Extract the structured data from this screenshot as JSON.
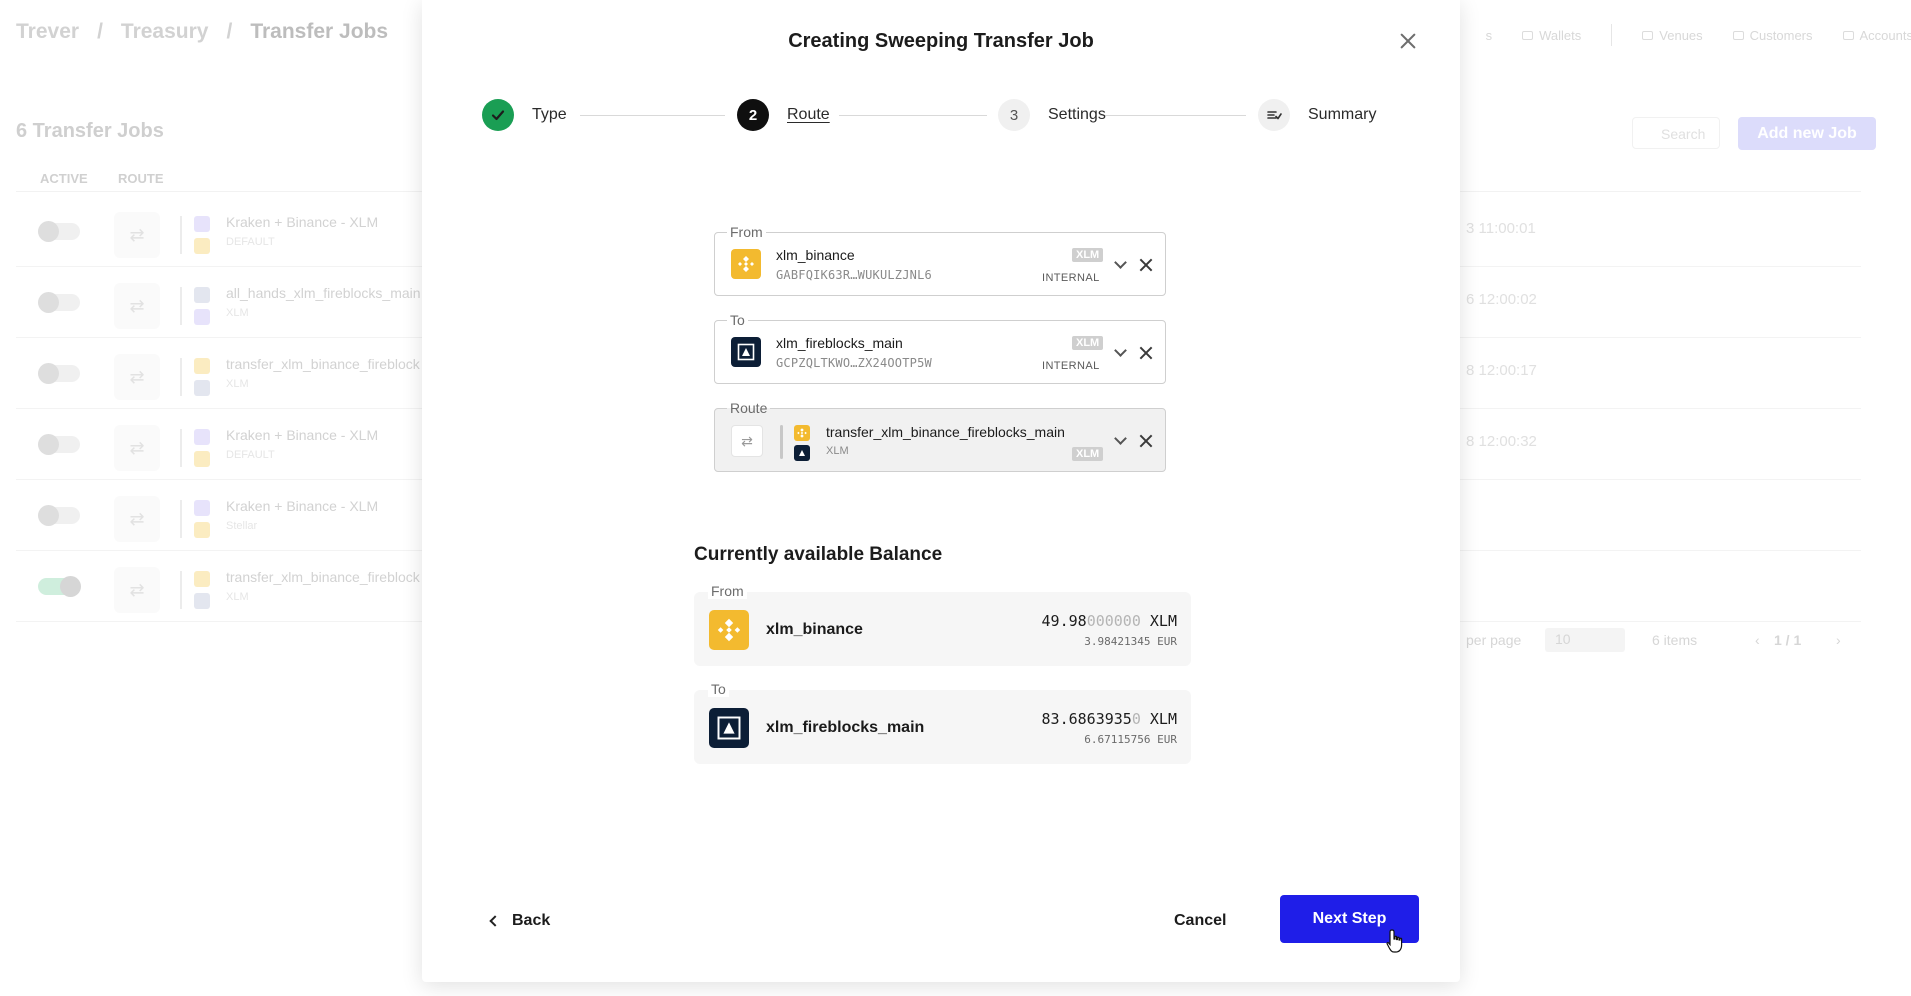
{
  "background": {
    "breadcrumb": [
      "Trever",
      "/",
      "Treasury",
      "/",
      "Transfer Jobs"
    ],
    "top_nav": [
      "s",
      "Wallets",
      "Venues",
      "Customers",
      "Accounts"
    ],
    "job_count": "6 Transfer Jobs",
    "search_placeholder": "Search",
    "add_job_label": "Add new Job",
    "columns": [
      "ACTIVE",
      "ROUTE"
    ],
    "rows": [
      {
        "name": "Kraken + Binance - XLM",
        "sub": "DEFAULT",
        "time": "3 11:00:01",
        "active": false
      },
      {
        "name": "all_hands_xlm_fireblocks_main",
        "sub": "XLM",
        "time": "6 12:00:02",
        "active": false
      },
      {
        "name": "transfer_xlm_binance_fireblock",
        "sub": "XLM",
        "time": "8 12:00:17",
        "active": false
      },
      {
        "name": "Kraken + Binance - XLM",
        "sub": "DEFAULT",
        "time": "8 12:00:32",
        "active": false
      },
      {
        "name": "Kraken + Binance - XLM",
        "sub": "Stellar",
        "time": "",
        "active": false
      },
      {
        "name": "transfer_xlm_binance_fireblock",
        "sub": "XLM",
        "time": "",
        "active": true
      }
    ],
    "pager": {
      "per_page_label": "per page",
      "per_page_value": "10",
      "items": "6 items",
      "page": "1 / 1"
    }
  },
  "modal": {
    "title": "Creating Sweeping Transfer Job",
    "steps": [
      {
        "label": "Type",
        "state": "done",
        "marker": ""
      },
      {
        "label": "Route",
        "state": "active",
        "marker": "2"
      },
      {
        "label": "Settings",
        "state": "todo",
        "marker": "3"
      },
      {
        "label": "Summary",
        "state": "todo",
        "marker": ""
      }
    ],
    "from_field": {
      "legend": "From",
      "name": "xlm_binance",
      "address": "GABFQIK63R…WUKULZJNL6",
      "asset": "XLM",
      "kind": "INTERNAL"
    },
    "to_field": {
      "legend": "To",
      "name": "xlm_fireblocks_main",
      "address": "GCPZQLTKWO…ZX24OOTP5W",
      "asset": "XLM",
      "kind": "INTERNAL"
    },
    "route_field": {
      "legend": "Route",
      "name": "transfer_xlm_binance_fireblocks_main",
      "sub": "XLM",
      "asset": "XLM"
    },
    "balance": {
      "title": "Currently available Balance",
      "from": {
        "legend": "From",
        "name": "xlm_binance",
        "amount_main": "49.98",
        "amount_dim": "000000",
        "unit": "XLM",
        "eur": "3.98421345 EUR"
      },
      "to": {
        "legend": "To",
        "name": "xlm_fireblocks_main",
        "amount_main": "83.6863935",
        "amount_dim": "0",
        "unit": "XLM",
        "eur": "6.67115756 EUR"
      }
    },
    "footer": {
      "back": "Back",
      "cancel": "Cancel",
      "next": "Next Step"
    }
  },
  "colors": {
    "accent": "#1f1ee8",
    "success": "#1a9e54",
    "binance": "#f3ba2f",
    "fireblocks": "#0c1e36"
  }
}
